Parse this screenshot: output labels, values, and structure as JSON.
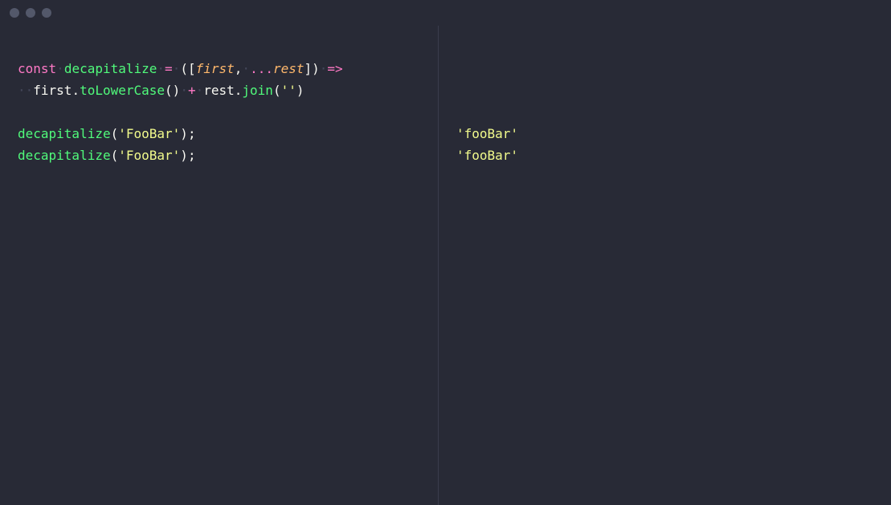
{
  "code": {
    "line1": {
      "const": "const",
      "space1": "·",
      "funcName": "decapitalize",
      "space2": "·",
      "eq": "=",
      "space3": "·",
      "openParen": "(",
      "openBracket": "[",
      "param1": "first",
      "comma": ",",
      "space4": "·",
      "spread": "...",
      "param2": "rest",
      "closeBracket": "]",
      "closeParen": ")",
      "space5": "·",
      "arrow": "=>"
    },
    "line2": {
      "indent": "··",
      "var1": "first",
      "dot1": ".",
      "method1": "toLowerCase",
      "parens1": "()",
      "space1": "·",
      "plus": "+",
      "space2": "·",
      "var2": "rest",
      "dot2": ".",
      "method2": "join",
      "openP": "(",
      "str": "''",
      "closeP": ")"
    },
    "line4": {
      "call": "decapitalize",
      "open": "(",
      "arg": "'FooBar'",
      "close": ")",
      "semi": ";"
    },
    "line5": {
      "call": "decapitalize",
      "open": "(",
      "arg": "'FooBar'",
      "close": ")",
      "semi": ";"
    }
  },
  "output": {
    "line1": "'fooBar'",
    "line2": "'fooBar'"
  }
}
